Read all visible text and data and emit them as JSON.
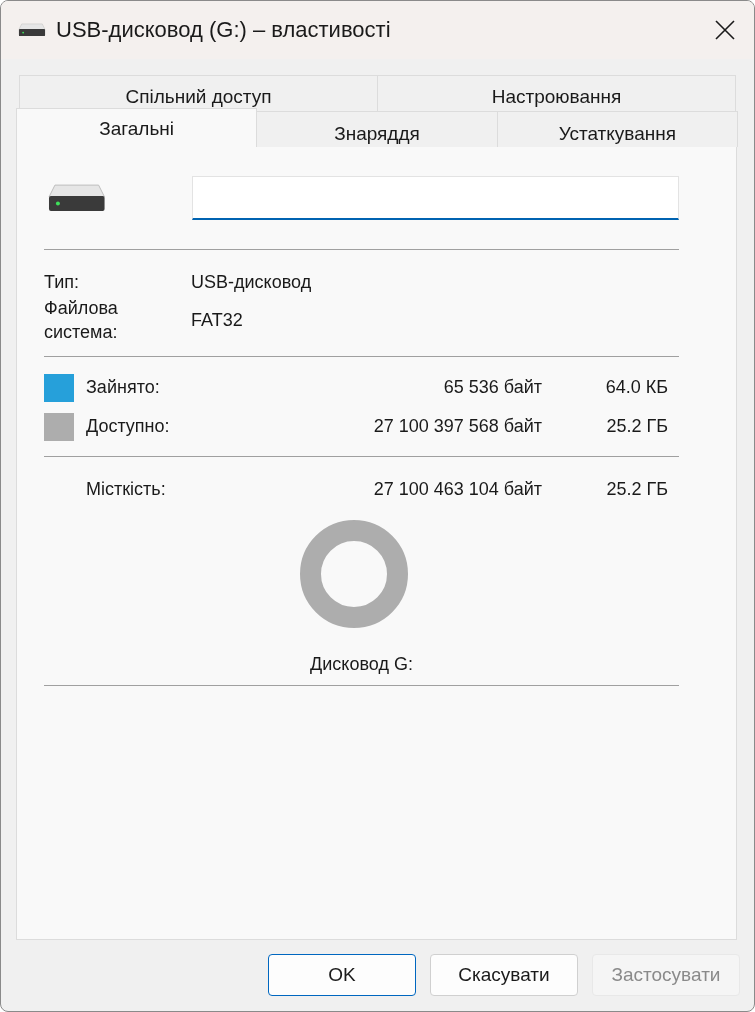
{
  "window": {
    "title": "USB-дисковод (G:) – властивості"
  },
  "tab_rows": [
    [
      {
        "label": "Спільний доступ",
        "selected": false
      },
      {
        "label": "Настроювання",
        "selected": false
      }
    ],
    [
      {
        "label": "Загальні",
        "selected": true
      },
      {
        "label": "Знаряддя",
        "selected": false
      },
      {
        "label": "Устаткування",
        "selected": false
      }
    ]
  ],
  "properties": [
    {
      "label": "Тип:",
      "value": "USB-дисковод"
    },
    {
      "label": "Файлова система:",
      "value": "FAT32"
    }
  ],
  "space": [
    {
      "label": "Зайнято:",
      "bytes": "65 536 байт",
      "size": "64.0 КБ",
      "color": "#26a0da"
    },
    {
      "label": "Доступно:",
      "bytes": "27 100 397 568 байт",
      "size": "25.2 ГБ",
      "color": "#adadad"
    }
  ],
  "capacity": {
    "label": "Місткість:",
    "bytes": "27 100 463 104 байт",
    "size": "25.2 ГБ"
  },
  "drive_label": "Дисковод G:",
  "buttons": [
    {
      "label": "OK",
      "kind": "default",
      "disabled": false
    },
    {
      "label": "Скасувати",
      "kind": "normal",
      "disabled": false
    },
    {
      "label": "Застосувати",
      "kind": "normal",
      "disabled": true
    }
  ]
}
